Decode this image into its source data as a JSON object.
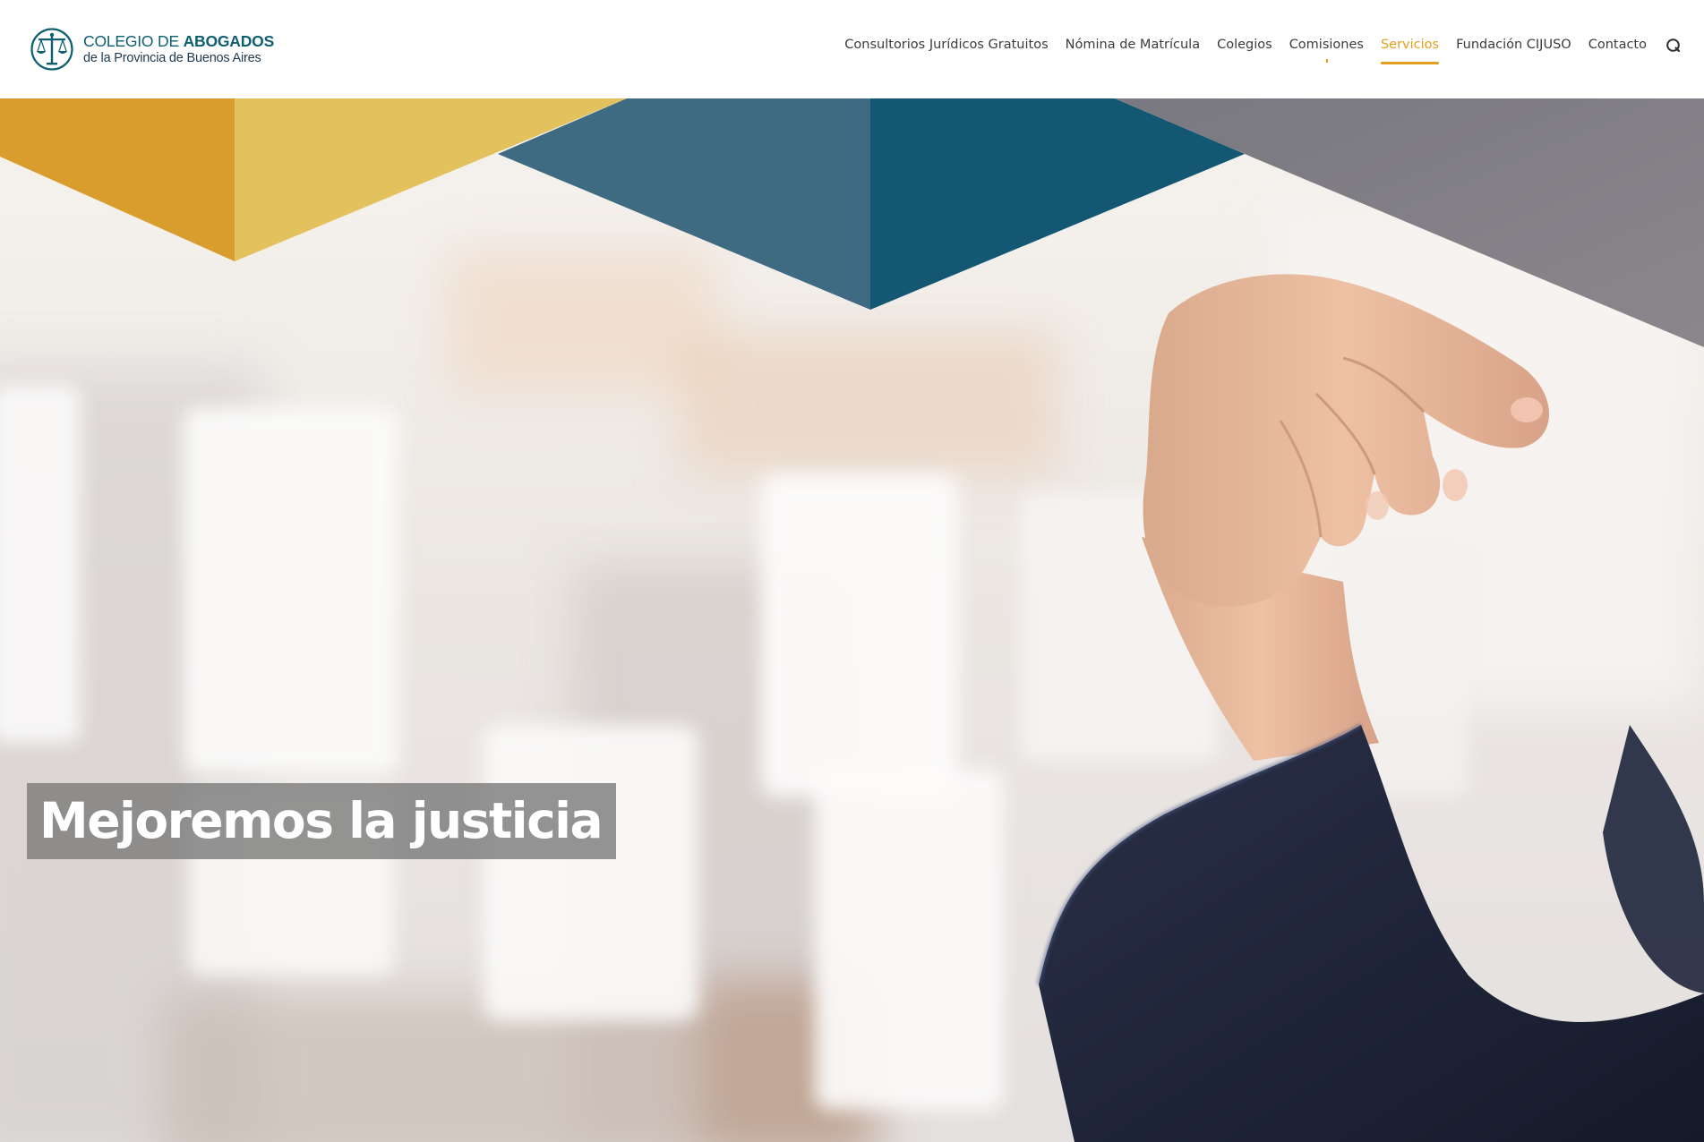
{
  "brand": {
    "name_regular": "COLEGIO DE ",
    "name_bold": "ABOGADOS",
    "subtitle": "de la Provincia de Buenos Aires",
    "primary_color": "#0e5f72",
    "accent_color": "#e2a01e"
  },
  "nav": {
    "items": [
      {
        "label": "Consultorios Jurídicos Gratuitos",
        "active": false
      },
      {
        "label": "Nómina de Matrícula",
        "active": false
      },
      {
        "label": "Colegios",
        "active": false
      },
      {
        "label": "Comisiones",
        "active": false
      },
      {
        "label": "Servicios",
        "active": true
      },
      {
        "label": "Fundación CIJUSO",
        "active": false
      },
      {
        "label": "Contacto",
        "active": false
      }
    ],
    "search_icon": "search-icon"
  },
  "hero": {
    "title": "Mejoremos la justicia",
    "colors": {
      "yellow_dark": "#d99d2e",
      "yellow_light": "#e3c15d",
      "teal_light": "#3e6b82",
      "teal_dark": "#145773",
      "gray": "#7e7c82",
      "sleeve": "#1c2236",
      "skin": "#e3b497"
    }
  }
}
